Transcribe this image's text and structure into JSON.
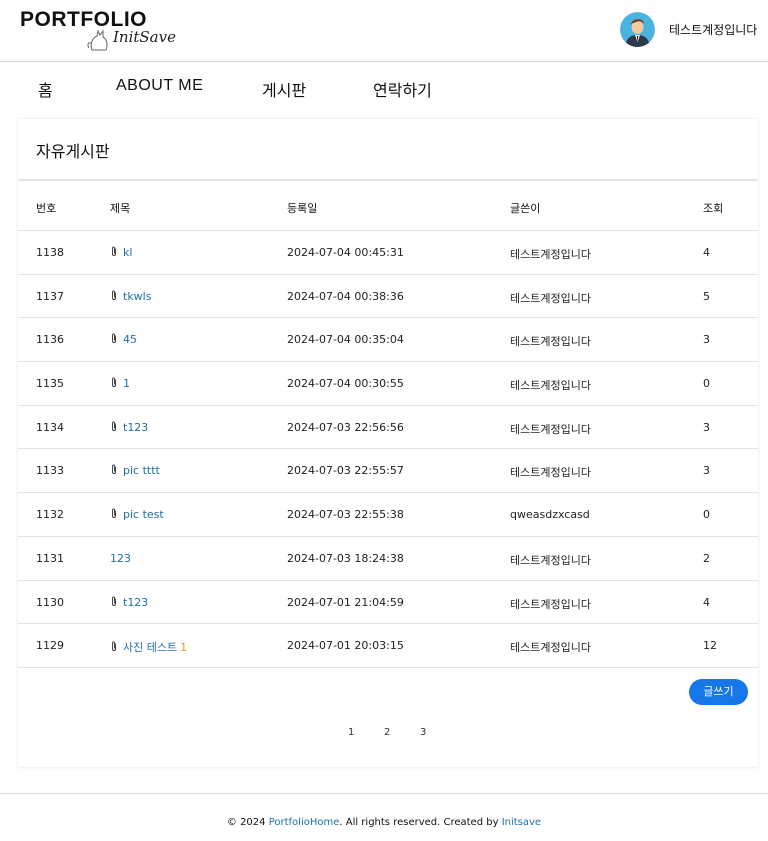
{
  "header": {
    "logo_main": "PORTFOLIO",
    "logo_sub": "InitSave",
    "user_name": "테스트계정입니다"
  },
  "nav": {
    "home": "홈",
    "about": "ABOUT ME",
    "board": "게시판",
    "contact": "연락하기"
  },
  "board": {
    "title": "자유게시판",
    "columns": {
      "no": "번호",
      "title": "제목",
      "date": "등록일",
      "author": "글쓴이",
      "views": "조회"
    },
    "rows": [
      {
        "no": "1138",
        "title": "kl",
        "attachment": true,
        "comments": "",
        "date": "2024-07-04 00:45:31",
        "author": "테스트계정입니다",
        "views": "4"
      },
      {
        "no": "1137",
        "title": "tkwls",
        "attachment": true,
        "comments": "",
        "date": "2024-07-04 00:38:36",
        "author": "테스트계정입니다",
        "views": "5"
      },
      {
        "no": "1136",
        "title": "45",
        "attachment": true,
        "comments": "",
        "date": "2024-07-04 00:35:04",
        "author": "테스트계정입니다",
        "views": "3"
      },
      {
        "no": "1135",
        "title": "1",
        "attachment": true,
        "comments": "",
        "date": "2024-07-04 00:30:55",
        "author": "테스트계정입니다",
        "views": "0"
      },
      {
        "no": "1134",
        "title": "t123",
        "attachment": true,
        "comments": "",
        "date": "2024-07-03 22:56:56",
        "author": "테스트계정입니다",
        "views": "3"
      },
      {
        "no": "1133",
        "title": "pic tttt",
        "attachment": true,
        "comments": "",
        "date": "2024-07-03 22:55:57",
        "author": "테스트계정입니다",
        "views": "3"
      },
      {
        "no": "1132",
        "title": "pic test",
        "attachment": true,
        "comments": "",
        "date": "2024-07-03 22:55:38",
        "author": "qweasdzxcasd",
        "views": "0"
      },
      {
        "no": "1131",
        "title": "123",
        "attachment": false,
        "comments": "",
        "date": "2024-07-03 18:24:38",
        "author": "테스트계정입니다",
        "views": "2"
      },
      {
        "no": "1130",
        "title": "t123",
        "attachment": true,
        "comments": "",
        "date": "2024-07-01 21:04:59",
        "author": "테스트계정입니다",
        "views": "4"
      },
      {
        "no": "1129",
        "title": "사진 테스트",
        "attachment": true,
        "comments": "1",
        "date": "2024-07-01 20:03:15",
        "author": "테스트계정입니다",
        "views": "12"
      }
    ],
    "write_button": "글쓰기",
    "pages": [
      "1",
      "2",
      "3"
    ]
  },
  "footer": {
    "prefix": "© 2024 ",
    "home_link": "PortfolioHome",
    "middle": ". All rights reserved. Created by ",
    "author_link": "Initsave"
  },
  "colors": {
    "link": "#1f6fa8",
    "accent_button": "#1677e8",
    "comment_count": "#c9a227"
  }
}
